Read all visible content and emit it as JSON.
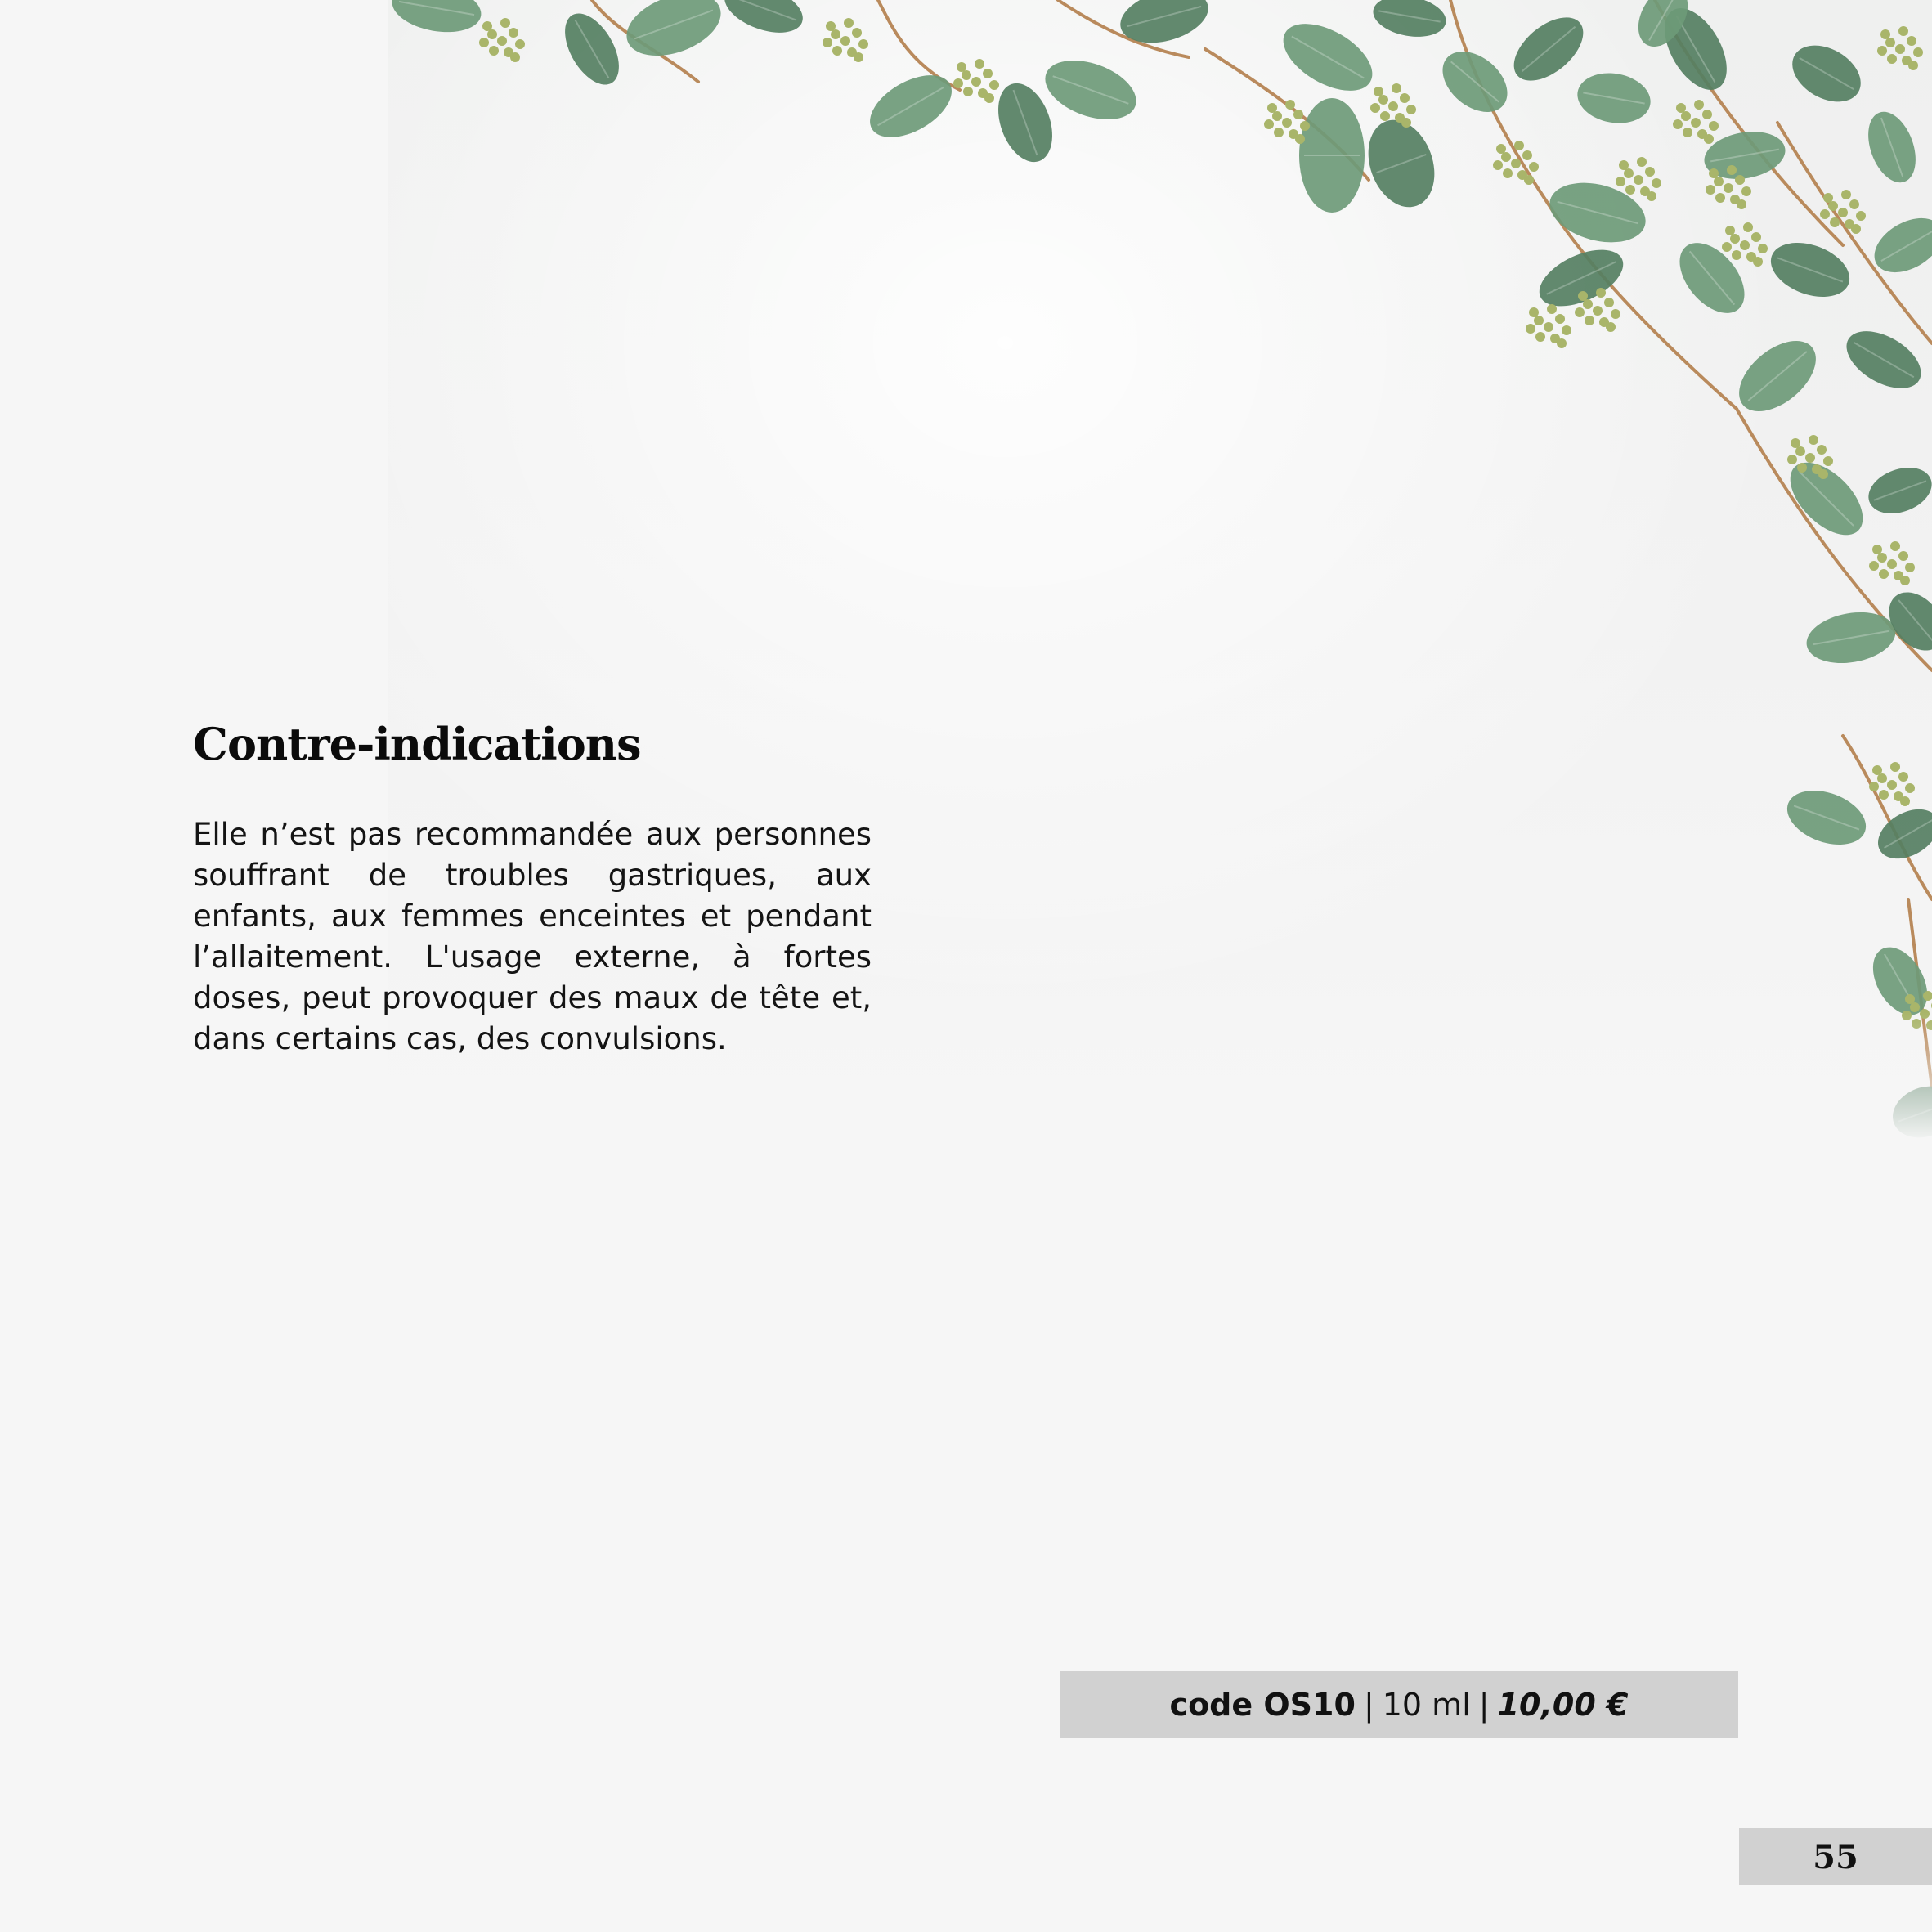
{
  "heading": "Contre-indications",
  "paragraph": "Elle n’est pas recommandée aux personnes souffrant de troubles gastriques, aux enfants, aux femmes enceintes et pendant l’allaitement. L'usage externe, à fortes doses, peut provoquer des maux de tête et, dans certains cas, des convulsions.",
  "product": {
    "code": "code OS10",
    "separator": "|",
    "volume": "10 ml",
    "price": "10,00 €"
  },
  "page_number": "55",
  "colors": {
    "page_background": "#f6f6f6",
    "bar_background": "#d1d1d1",
    "leaf": "#6e9a78",
    "leaf_dark": "#557f62",
    "stem": "#b98a5c",
    "bud": "#a9b56a"
  }
}
